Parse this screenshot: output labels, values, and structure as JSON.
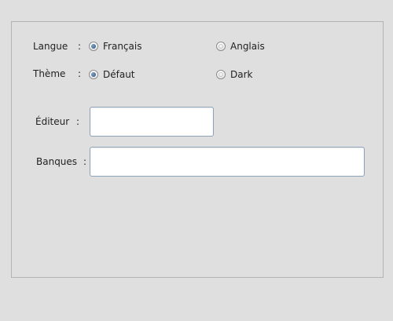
{
  "preferences": {
    "language": {
      "label": "Langue",
      "colon": ":",
      "options": [
        {
          "label": "Français",
          "selected": true
        },
        {
          "label": "Anglais",
          "selected": false
        }
      ]
    },
    "theme": {
      "label": "Thème",
      "colon": ":",
      "options": [
        {
          "label": "Défaut",
          "selected": true
        },
        {
          "label": "Dark",
          "selected": false
        }
      ]
    },
    "editor": {
      "label": "Éditeur",
      "colon": ":",
      "value": ""
    },
    "banks": {
      "label": "Banques",
      "colon": ":",
      "value": ""
    }
  }
}
